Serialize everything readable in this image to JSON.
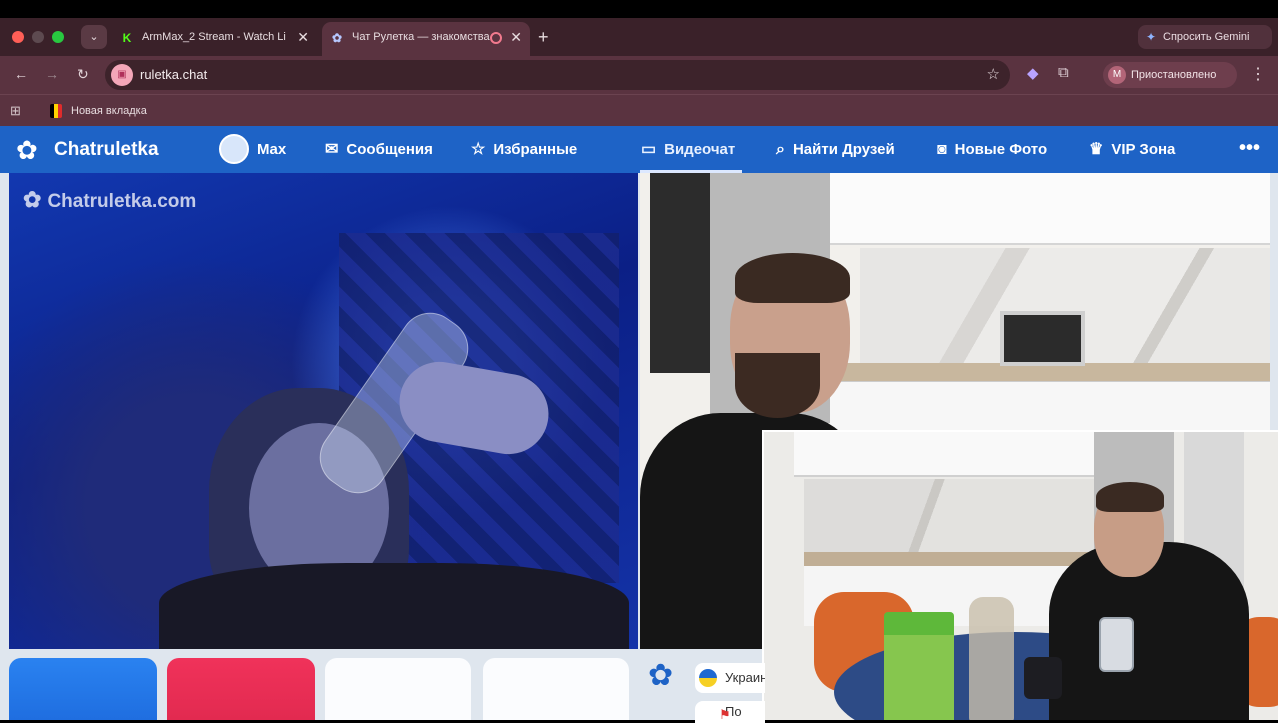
{
  "browser": {
    "tabs": [
      {
        "title": "ArmMax_2 Stream - Watch Li",
        "favicon": "kick-icon"
      },
      {
        "title": "Чат Рулетка — знакомства",
        "favicon": "chatruletka-icon"
      }
    ],
    "gemini_label": "Спросить Gemini",
    "url": "ruletka.chat",
    "profile_status": "Приостановлено",
    "profile_initial": "M",
    "bookmark": "Новая вкладка"
  },
  "site_nav": {
    "logo": "Chatruletka",
    "user_name": "Max",
    "items": [
      {
        "label": "Сообщения",
        "icon": "envelope-icon"
      },
      {
        "label": "Избранные",
        "icon": "star-icon"
      },
      {
        "label": "Видеочат",
        "icon": "video-camera-icon"
      },
      {
        "label": "Найти Друзей",
        "icon": "search-icon"
      },
      {
        "label": "Новые Фото",
        "icon": "camera-icon"
      },
      {
        "label": "VIP Зона",
        "icon": "crown-icon"
      }
    ],
    "more": "•••"
  },
  "video": {
    "watermark": "Chatruletka.com"
  },
  "controls": {
    "country": "Украина",
    "report": "По"
  },
  "colors": {
    "brand_blue": "#1e63c6",
    "start_button": "#2a82f0",
    "stop_button": "#f0325a"
  }
}
